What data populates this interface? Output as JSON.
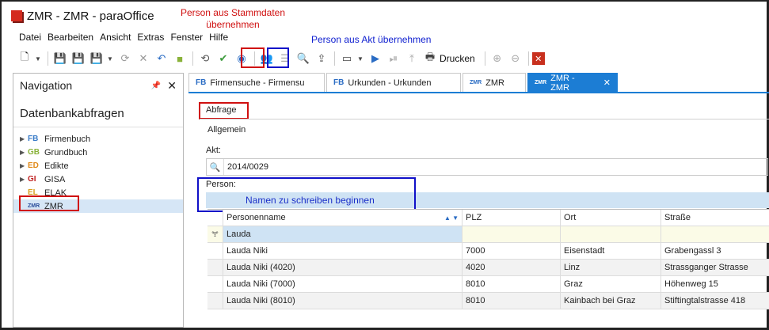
{
  "window": {
    "title": "ZMR - ZMR - paraOffice"
  },
  "menu": [
    "Datei",
    "Bearbeiten",
    "Ansicht",
    "Extras",
    "Fenster",
    "Hilfe"
  ],
  "toolbar": {
    "print_label": "Drucken"
  },
  "annotations": {
    "red": "Person aus Stammdaten übernehmen",
    "blue": "Person aus Akt übernehmen"
  },
  "navigation": {
    "title": "Navigation",
    "section": "Datenbankabfragen",
    "items": [
      {
        "tag": "FB",
        "label": "Firmenbuch",
        "color": "#3a7cc8"
      },
      {
        "tag": "GB",
        "label": "Grundbuch",
        "color": "#8ab23a"
      },
      {
        "tag": "ED",
        "label": "Edikte",
        "color": "#e08a1a"
      },
      {
        "tag": "GI",
        "label": "GISA",
        "color": "#c02020"
      },
      {
        "tag": "EL",
        "label": "ELAK",
        "color": "#d8a020"
      },
      {
        "tag": "ZMR",
        "label": "ZMR",
        "color": "#2a4c9a"
      }
    ]
  },
  "tabs": [
    {
      "tag": "FB",
      "label": "Firmensuche - Firmensu"
    },
    {
      "tag": "FB",
      "label": "Urkunden - Urkunden"
    },
    {
      "tag": "ZMR",
      "label": "ZMR"
    },
    {
      "tag": "ZMR",
      "label": "ZMR - ZMR"
    }
  ],
  "form": {
    "abfrage_label": "Abfrage",
    "group_label": "Allgemein",
    "akt_label": "Akt:",
    "akt_value": "2014/0029",
    "person_label": "Person:",
    "hint": "Namen zu schreiben beginnen"
  },
  "grid": {
    "columns": [
      "Personenname",
      "PLZ",
      "Ort",
      "Straße"
    ],
    "filter_value": "Lauda",
    "rows": [
      [
        "Lauda Niki",
        "7000",
        "Eisenstadt",
        "Grabengassl 3"
      ],
      [
        "Lauda Niki (4020)",
        "4020",
        "Linz",
        "Strassganger Strasse"
      ],
      [
        "Lauda Niki (7000)",
        "8010",
        "Graz",
        "Höhenweg 15"
      ],
      [
        "Lauda Niki (8010)",
        "8010",
        "Kainbach bei Graz",
        "Stiftingtalstrasse 418"
      ]
    ]
  }
}
